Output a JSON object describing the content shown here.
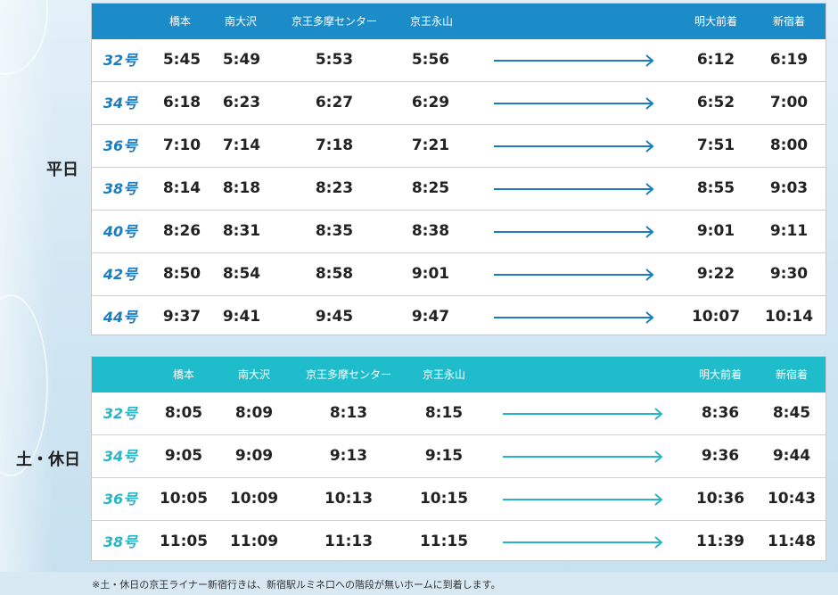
{
  "colors": {
    "weekday_header": "#1b8cc8",
    "holiday_header": "#1fbccb",
    "weekday_accent": "#1b7dc0",
    "holiday_accent": "#27b6c8"
  },
  "headers": {
    "weekday": [
      "橋本",
      "南大沢",
      "京王多摩センター",
      "京王永山",
      "明大前着",
      "新宿着"
    ],
    "holiday": [
      "橋本",
      "南大沢",
      "京王多摩センター",
      "京王永山",
      "明大前着",
      "新宿着"
    ]
  },
  "weekday": {
    "label": "平日",
    "rows": [
      {
        "no": "32号",
        "times": [
          "5:45",
          "5:49",
          "5:53",
          "5:56",
          "6:12",
          "6:19"
        ]
      },
      {
        "no": "34号",
        "times": [
          "6:18",
          "6:23",
          "6:27",
          "6:29",
          "6:52",
          "7:00"
        ]
      },
      {
        "no": "36号",
        "times": [
          "7:10",
          "7:14",
          "7:18",
          "7:21",
          "7:51",
          "8:00"
        ]
      },
      {
        "no": "38号",
        "times": [
          "8:14",
          "8:18",
          "8:23",
          "8:25",
          "8:55",
          "9:03"
        ]
      },
      {
        "no": "40号",
        "times": [
          "8:26",
          "8:31",
          "8:35",
          "8:38",
          "9:01",
          "9:11"
        ]
      },
      {
        "no": "42号",
        "times": [
          "8:50",
          "8:54",
          "8:58",
          "9:01",
          "9:22",
          "9:30"
        ]
      },
      {
        "no": "44号",
        "times": [
          "9:37",
          "9:41",
          "9:45",
          "9:47",
          "10:07",
          "10:14"
        ]
      }
    ]
  },
  "holiday": {
    "label": "土・休日",
    "rows": [
      {
        "no": "32号",
        "times": [
          "8:05",
          "8:09",
          "8:13",
          "8:15",
          "8:36",
          "8:45"
        ]
      },
      {
        "no": "34号",
        "times": [
          "9:05",
          "9:09",
          "9:13",
          "9:15",
          "9:36",
          "9:44"
        ]
      },
      {
        "no": "36号",
        "times": [
          "10:05",
          "10:09",
          "10:13",
          "10:15",
          "10:36",
          "10:43"
        ]
      },
      {
        "no": "38号",
        "times": [
          "11:05",
          "11:09",
          "11:13",
          "11:15",
          "11:39",
          "11:48"
        ]
      }
    ]
  },
  "footnote": "※土・休日の京王ライナー新宿行きは、新宿駅ルミネ口への階段が無いホームに到着します。"
}
